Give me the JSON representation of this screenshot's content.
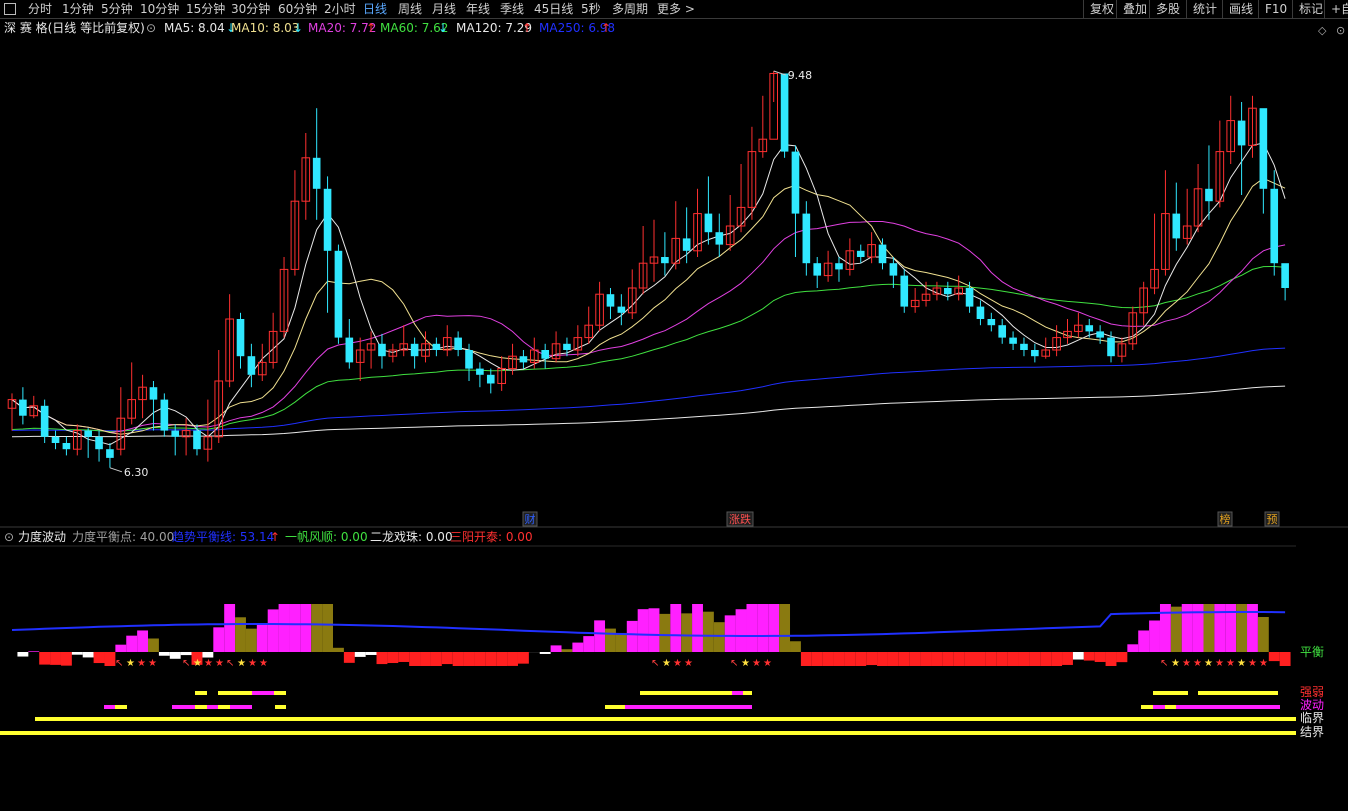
{
  "toolbar": {
    "tabs": [
      "分时",
      "1分钟",
      "5分钟",
      "10分钟",
      "15分钟",
      "30分钟",
      "60分钟",
      "2小时",
      "日线",
      "周线",
      "月线",
      "年线",
      "季线",
      "45日线",
      "5秒",
      "多周期",
      "更多 >"
    ],
    "active_tab": "日线",
    "right_buttons": [
      "复权",
      "叠加",
      "多股",
      "统计",
      "画线",
      "F10",
      "标记",
      "+自"
    ]
  },
  "header": {
    "title": "深 赛 格(日线 等比前复权)",
    "ma": [
      {
        "label": "MA5: 8.04",
        "arrow": "↓",
        "color": "#e8e8e8",
        "arrow_color": "#30e8ff"
      },
      {
        "label": "MA10: 8.03",
        "arrow": "↓",
        "color": "#f0e090",
        "arrow_color": "#30e8ff"
      },
      {
        "label": "MA20: 7.72",
        "arrow": "↑",
        "color": "#e040e0",
        "arrow_color": "#ff3030"
      },
      {
        "label": "MA60: 7.62",
        "arrow": "↓",
        "color": "#40e040",
        "arrow_color": "#30e8ff"
      },
      {
        "label": "MA120: 7.29",
        "arrow": "↑",
        "color": "#e8e8e8",
        "arrow_color": "#ff3030"
      },
      {
        "label": "MA250: 6.98",
        "arrow": "↑",
        "color": "#2030ff",
        "arrow_color": "#ff3030"
      }
    ]
  },
  "indicator_header": {
    "name": "力度波动",
    "items": [
      {
        "label": "力度平衡点: 40.00",
        "color": "#a0a0a0"
      },
      {
        "label": "趋势平衡线: 53.14",
        "arrow": "↑",
        "color": "#2030ff",
        "arrow_color": "#ff3030"
      },
      {
        "label": "一帆风顺: 0.00",
        "color": "#40e040"
      },
      {
        "label": "二龙戏珠: 0.00",
        "color": "#e8e8e8"
      },
      {
        "label": "三阳开泰: 0.00",
        "color": "#ff3030"
      }
    ]
  },
  "events": [
    "财",
    "涨跌",
    "榜",
    "预"
  ],
  "right_labels": {
    "balance": "平衡",
    "strength": "强弱",
    "wave": "波动",
    "critical": "临界",
    "boundary": "结界"
  },
  "colors": {
    "up": "#ff3030",
    "down": "#30e8ff",
    "ma5": "#e8e8e8",
    "ma10": "#f0e090",
    "ma20": "#e040e0",
    "ma60": "#40e040",
    "ma120": "#e8e8e8",
    "ma250": "#2030ff",
    "hist_pos": "#ff20ff",
    "hist_olive": "#8a7a10",
    "hist_neg": "#ffffff",
    "hist_red": "#ff2020",
    "trend": "#2030ff",
    "bar_yellow": "#ffff30",
    "bar_magenta": "#ff20ff"
  },
  "chart_data": {
    "type": "candlestick",
    "price_range": [
      6.0,
      9.75
    ],
    "high_label": "9.48",
    "low_label": "6.30",
    "candles": [
      [
        6.78,
        6.85,
        6.9,
        6.6
      ],
      [
        6.85,
        6.72,
        6.95,
        6.65
      ],
      [
        6.72,
        6.8,
        6.88,
        6.7
      ],
      [
        6.8,
        6.55,
        6.85,
        6.5
      ],
      [
        6.55,
        6.5,
        6.6,
        6.45
      ],
      [
        6.5,
        6.45,
        6.55,
        6.4
      ],
      [
        6.45,
        6.6,
        6.65,
        6.4
      ],
      [
        6.6,
        6.55,
        6.62,
        6.38
      ],
      [
        6.55,
        6.45,
        6.6,
        6.35
      ],
      [
        6.45,
        6.38,
        6.5,
        6.3
      ],
      [
        6.45,
        6.7,
        6.95,
        6.4
      ],
      [
        6.7,
        6.85,
        7.15,
        6.65
      ],
      [
        6.85,
        6.95,
        7.05,
        6.7
      ],
      [
        6.95,
        6.85,
        7.0,
        6.6
      ],
      [
        6.85,
        6.6,
        6.9,
        6.55
      ],
      [
        6.6,
        6.55,
        6.65,
        6.4
      ],
      [
        6.55,
        6.6,
        6.7,
        6.4
      ],
      [
        6.6,
        6.45,
        6.65,
        6.4
      ],
      [
        6.45,
        6.55,
        6.85,
        6.35
      ],
      [
        6.55,
        7.0,
        7.25,
        6.5
      ],
      [
        7.0,
        7.5,
        7.7,
        6.95
      ],
      [
        7.5,
        7.2,
        7.55,
        7.1
      ],
      [
        7.2,
        7.05,
        7.3,
        6.95
      ],
      [
        7.05,
        7.15,
        7.3,
        7.0
      ],
      [
        7.15,
        7.4,
        7.55,
        7.1
      ],
      [
        7.4,
        7.9,
        8.0,
        7.35
      ],
      [
        7.9,
        8.45,
        8.7,
        7.85
      ],
      [
        8.45,
        8.8,
        9.0,
        8.3
      ],
      [
        8.8,
        8.55,
        9.2,
        8.3
      ],
      [
        8.55,
        8.05,
        8.65,
        7.55
      ],
      [
        8.05,
        7.35,
        8.1,
        7.3
      ],
      [
        7.35,
        7.15,
        7.5,
        7.1
      ],
      [
        7.15,
        7.25,
        7.35,
        7.0
      ],
      [
        7.25,
        7.3,
        7.4,
        7.1
      ],
      [
        7.3,
        7.2,
        7.38,
        7.1
      ],
      [
        7.2,
        7.25,
        7.3,
        7.15
      ],
      [
        7.25,
        7.3,
        7.45,
        7.2
      ],
      [
        7.3,
        7.2,
        7.35,
        7.1
      ],
      [
        7.2,
        7.3,
        7.4,
        7.15
      ],
      [
        7.3,
        7.25,
        7.35,
        7.2
      ],
      [
        7.25,
        7.35,
        7.45,
        7.2
      ],
      [
        7.35,
        7.25,
        7.4,
        7.2
      ],
      [
        7.25,
        7.1,
        7.3,
        7.0
      ],
      [
        7.1,
        7.05,
        7.15,
        6.95
      ],
      [
        7.05,
        6.98,
        7.1,
        6.9
      ],
      [
        6.98,
        7.1,
        7.2,
        6.92
      ],
      [
        7.1,
        7.2,
        7.3,
        7.05
      ],
      [
        7.2,
        7.15,
        7.25,
        7.1
      ],
      [
        7.15,
        7.25,
        7.35,
        7.1
      ],
      [
        7.25,
        7.18,
        7.3,
        7.1
      ],
      [
        7.18,
        7.3,
        7.4,
        7.15
      ],
      [
        7.3,
        7.25,
        7.35,
        7.2
      ],
      [
        7.25,
        7.35,
        7.45,
        7.2
      ],
      [
        7.35,
        7.45,
        7.6,
        7.3
      ],
      [
        7.45,
        7.7,
        7.8,
        7.4
      ],
      [
        7.7,
        7.6,
        7.75,
        7.5
      ],
      [
        7.6,
        7.55,
        7.7,
        7.45
      ],
      [
        7.55,
        7.75,
        7.9,
        7.5
      ],
      [
        7.75,
        7.95,
        8.25,
        7.7
      ],
      [
        7.95,
        8.0,
        8.3,
        7.8
      ],
      [
        8.0,
        7.95,
        8.2,
        7.85
      ],
      [
        7.95,
        8.15,
        8.45,
        7.9
      ],
      [
        8.15,
        8.05,
        8.4,
        7.95
      ],
      [
        8.05,
        8.35,
        8.55,
        8.0
      ],
      [
        8.35,
        8.2,
        8.65,
        8.1
      ],
      [
        8.2,
        8.1,
        8.35,
        8.0
      ],
      [
        8.1,
        8.25,
        8.5,
        8.05
      ],
      [
        8.25,
        8.4,
        8.75,
        8.2
      ],
      [
        8.4,
        8.85,
        9.05,
        8.3
      ],
      [
        8.85,
        8.95,
        9.3,
        8.8
      ],
      [
        8.95,
        9.48,
        9.5,
        9.25
      ],
      [
        9.48,
        8.85,
        9.3,
        8.8
      ],
      [
        8.85,
        8.35,
        8.9,
        8.0
      ],
      [
        8.35,
        7.95,
        8.45,
        7.85
      ],
      [
        7.95,
        7.85,
        8.0,
        7.75
      ],
      [
        7.85,
        7.95,
        8.05,
        7.8
      ],
      [
        7.95,
        7.9,
        8.0,
        7.8
      ],
      [
        7.9,
        8.05,
        8.15,
        7.85
      ],
      [
        8.05,
        8.0,
        8.1,
        7.95
      ],
      [
        8.0,
        8.1,
        8.2,
        7.95
      ],
      [
        8.1,
        7.95,
        8.15,
        7.9
      ],
      [
        7.95,
        7.85,
        8.0,
        7.75
      ],
      [
        7.85,
        7.6,
        7.9,
        7.55
      ],
      [
        7.6,
        7.65,
        7.75,
        7.55
      ],
      [
        7.65,
        7.7,
        7.8,
        7.6
      ],
      [
        7.7,
        7.75,
        7.8,
        7.65
      ],
      [
        7.75,
        7.7,
        7.8,
        7.65
      ],
      [
        7.7,
        7.75,
        7.85,
        7.65
      ],
      [
        7.75,
        7.6,
        7.8,
        7.55
      ],
      [
        7.6,
        7.5,
        7.65,
        7.45
      ],
      [
        7.5,
        7.45,
        7.55,
        7.4
      ],
      [
        7.45,
        7.35,
        7.5,
        7.3
      ],
      [
        7.35,
        7.3,
        7.4,
        7.25
      ],
      [
        7.3,
        7.25,
        7.35,
        7.2
      ],
      [
        7.25,
        7.2,
        7.3,
        7.15
      ],
      [
        7.2,
        7.25,
        7.35,
        7.18
      ],
      [
        7.25,
        7.35,
        7.45,
        7.2
      ],
      [
        7.35,
        7.4,
        7.5,
        7.3
      ],
      [
        7.4,
        7.45,
        7.55,
        7.35
      ],
      [
        7.45,
        7.4,
        7.5,
        7.35
      ],
      [
        7.4,
        7.35,
        7.45,
        7.3
      ],
      [
        7.35,
        7.2,
        7.4,
        7.15
      ],
      [
        7.2,
        7.3,
        7.35,
        7.15
      ],
      [
        7.3,
        7.55,
        7.6,
        7.25
      ],
      [
        7.55,
        7.75,
        7.8,
        7.45
      ],
      [
        7.75,
        7.9,
        8.35,
        7.7
      ],
      [
        7.9,
        8.35,
        8.7,
        7.85
      ],
      [
        8.35,
        8.15,
        8.6,
        8.05
      ],
      [
        8.15,
        8.25,
        8.55,
        8.1
      ],
      [
        8.25,
        8.55,
        8.75,
        8.2
      ],
      [
        8.55,
        8.45,
        8.9,
        8.3
      ],
      [
        8.45,
        8.85,
        9.1,
        8.4
      ],
      [
        8.85,
        9.1,
        9.3,
        8.75
      ],
      [
        9.1,
        8.9,
        9.25,
        8.5
      ],
      [
        8.9,
        9.2,
        9.3,
        8.8
      ],
      [
        9.2,
        8.55,
        9.05,
        8.35
      ],
      [
        8.55,
        7.95,
        8.7,
        7.85
      ],
      [
        7.95,
        7.75,
        7.9,
        7.65
      ]
    ],
    "balance_point": 40.0,
    "trend_balance": 53.14
  }
}
